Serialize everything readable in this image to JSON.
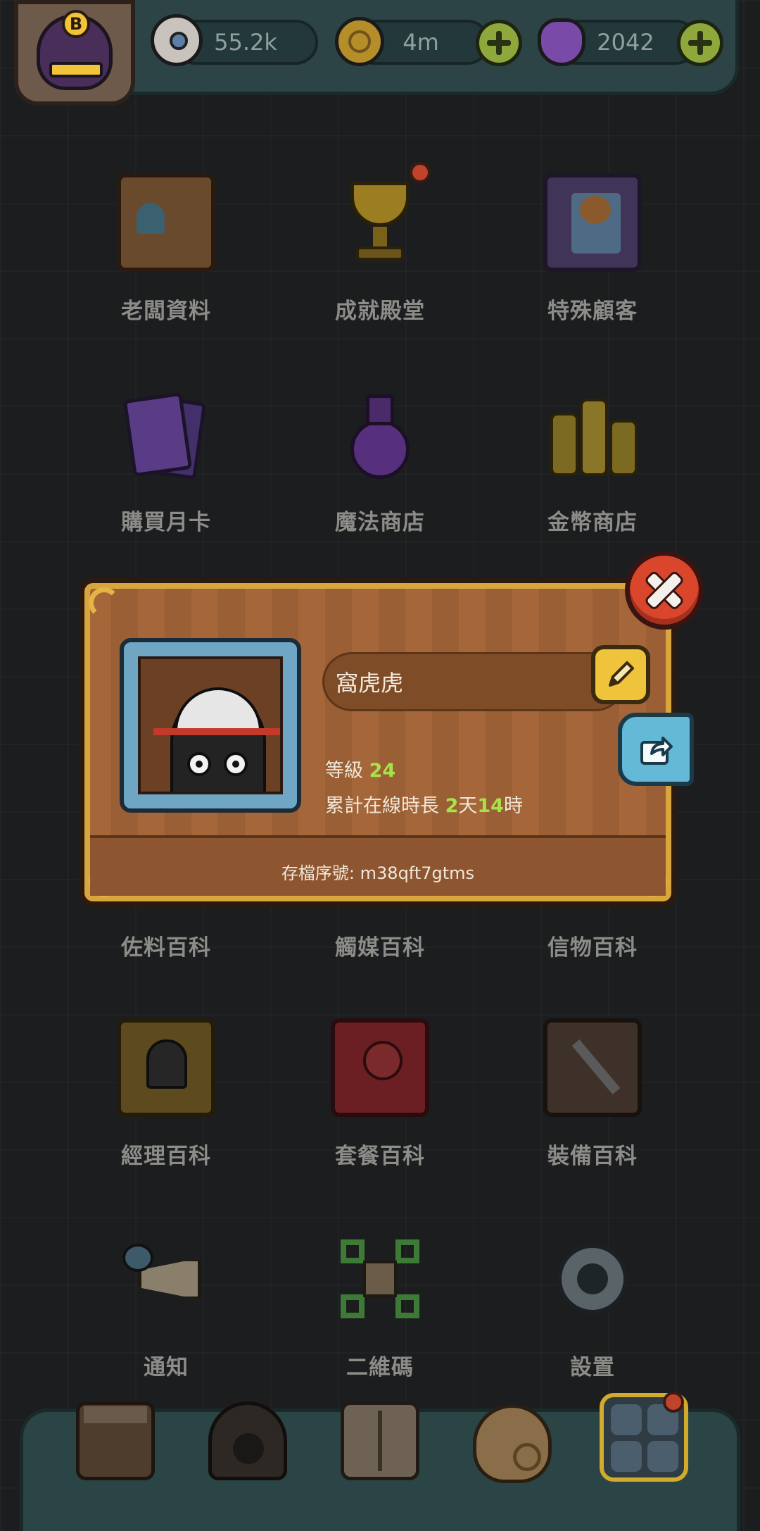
{
  "resources": {
    "eyeballs": "55.2k",
    "coins": "4m",
    "potions": "2042"
  },
  "avatar_badge_letter": "B",
  "menu": [
    {
      "label": "老闆資料",
      "icon": "boss-profile-card-icon"
    },
    {
      "label": "成就殿堂",
      "icon": "trophy-icon"
    },
    {
      "label": "特殊顧客",
      "icon": "special-customer-portrait-icon"
    },
    {
      "label": "購買月卡",
      "icon": "monthly-card-icon"
    },
    {
      "label": "魔法商店",
      "icon": "magic-potion-shop-icon"
    },
    {
      "label": "金幣商店",
      "icon": "gold-coin-shop-icon"
    },
    {
      "label": "佐料百科",
      "icon": "seasoning-book-icon"
    },
    {
      "label": "觸媒百科",
      "icon": "catalyst-book-icon"
    },
    {
      "label": "信物百科",
      "icon": "token-book-icon"
    },
    {
      "label": "經理百科",
      "icon": "manager-book-icon"
    },
    {
      "label": "套餐百科",
      "icon": "meal-set-book-icon"
    },
    {
      "label": "裝備百科",
      "icon": "equipment-book-icon"
    },
    {
      "label": "通知",
      "icon": "megaphone-icon"
    },
    {
      "label": "二維碼",
      "icon": "qr-code-icon"
    },
    {
      "label": "設置",
      "icon": "gear-icon"
    }
  ],
  "profile_dialog": {
    "name": "窩虎虎",
    "level_label": "等級",
    "level_value": "24",
    "online_label": "累計在線時長",
    "online_days": "2",
    "days_unit": "天",
    "online_hours": "14",
    "hours_unit": "時",
    "save_id": "存檔序號: m38qft7gtms"
  },
  "bottom_nav": [
    {
      "icon": "shop-building-icon"
    },
    {
      "icon": "dungeon-monster-icon"
    },
    {
      "icon": "open-book-icon"
    },
    {
      "icon": "money-bag-icon"
    },
    {
      "icon": "menu-grid-icon",
      "active": true
    }
  ],
  "colors": {
    "accent_green": "#a6e34a",
    "close_red": "#d9462c",
    "edit_yellow": "#efc43a",
    "share_blue": "#63b9d6"
  }
}
